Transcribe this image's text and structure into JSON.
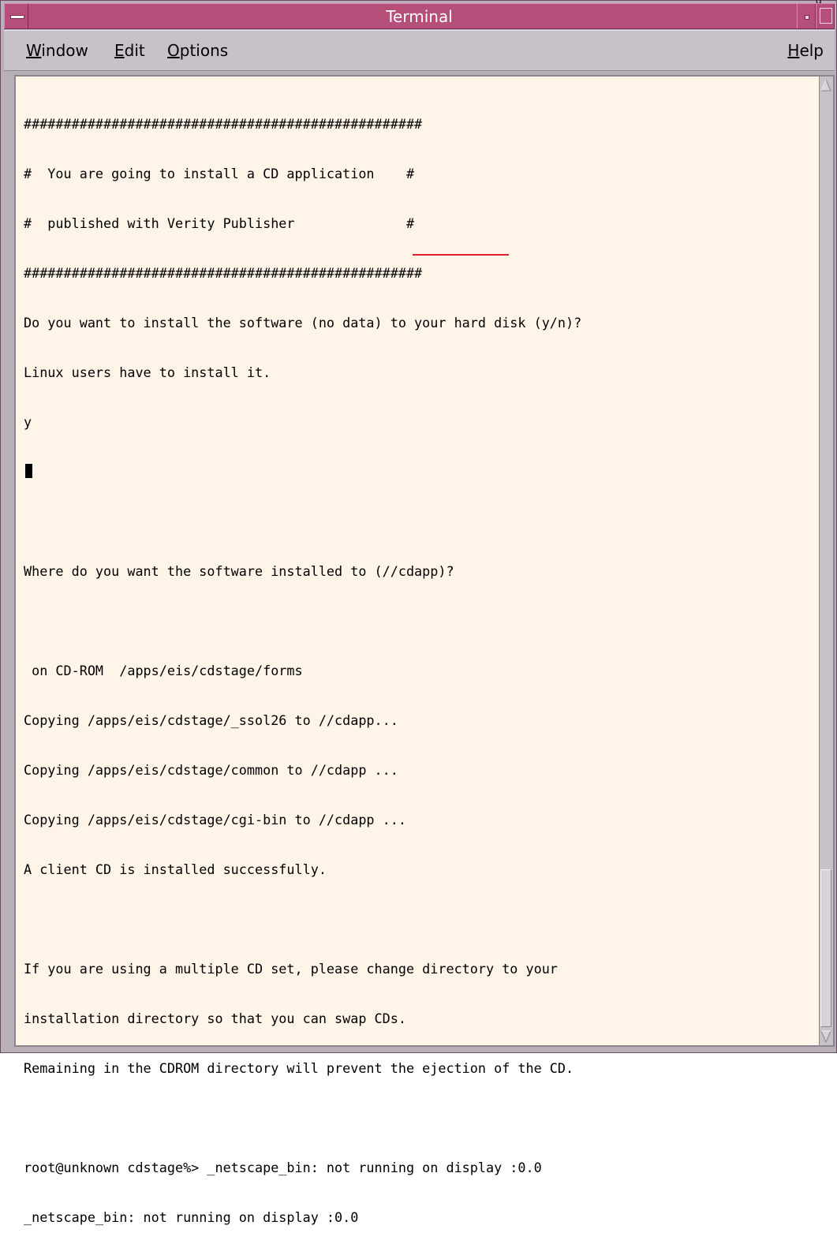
{
  "window": {
    "title": "Terminal",
    "title_bar_color": "#b64e7a",
    "background_color": "#fff4e8",
    "trimmed_text": "g"
  },
  "menubar": {
    "items": [
      {
        "label": "Window",
        "mnemonic": "W",
        "rest": "indow"
      },
      {
        "label": "Edit",
        "mnemonic": "E",
        "rest": "dit"
      },
      {
        "label": "Options",
        "mnemonic": "O",
        "rest": "ptions"
      }
    ],
    "help": {
      "label": "Help",
      "mnemonic": "H",
      "rest": "elp"
    }
  },
  "terminal": {
    "lines": [
      "##################################################",
      "#  You are going to install a CD application    #",
      "#  published with Verity Publisher              #",
      "##################################################",
      "Do you want to install the software (no data) to your hard disk (y/n)?",
      "Linux users have to install it.",
      "y",
      "",
      "",
      "Where do you want the software installed to (//cdapp)?",
      "",
      " on CD-ROM  /apps/eis/cdstage/forms",
      "Copying /apps/eis/cdstage/_ssol26 to //cdapp...",
      "Copying /apps/eis/cdstage/common to //cdapp ...",
      "Copying /apps/eis/cdstage/cgi-bin to //cdapp ...",
      "A client CD is installed successfully.",
      "",
      "If you are using a multiple CD set, please change directory to your",
      "installation directory so that you can swap CDs.",
      "Remaining in the CDROM directory will prevent the ejection of the CD.",
      "",
      "root@unknown cdstage%> _netscape_bin: not running on display :0.0",
      "_netscape_bin: not running on display :0.0"
    ],
    "highlight_color": "#e0202a",
    "highlighted_text": "(//cdapp)"
  },
  "icons": {
    "window_menu": "window-menu-icon",
    "minimize": "minimize-icon",
    "maximize": "maximize-icon",
    "scroll_up": "arrow-up-icon",
    "scroll_down": "arrow-down-icon"
  }
}
